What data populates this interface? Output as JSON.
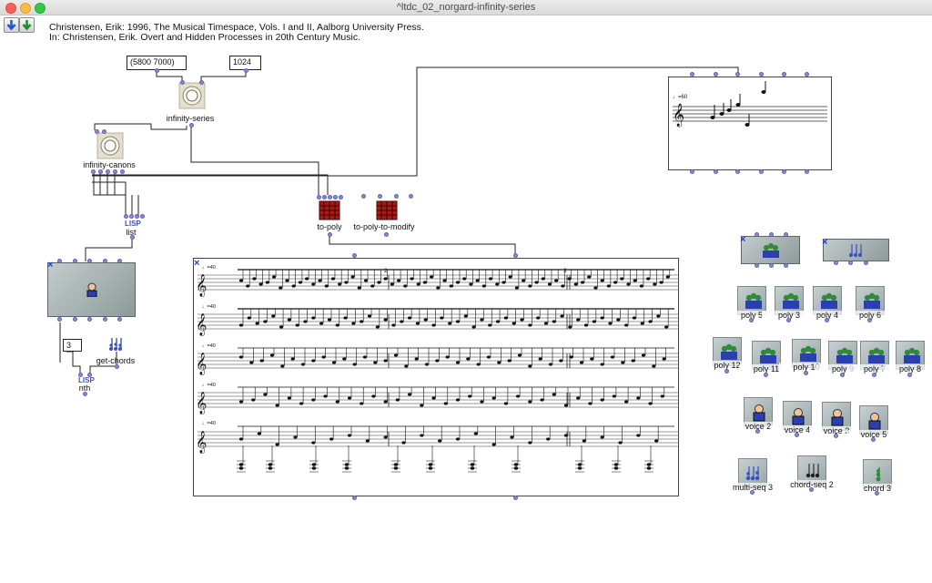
{
  "window": {
    "title": "^ltdc_02_norgard-infinity-series"
  },
  "toolbar": {
    "back_icon": "arrow-down-blue",
    "forward_icon": "arrow-down-green"
  },
  "credits": {
    "line1": "Christensen, Erik: 1996, The Musical Timespace, Vols. I and II, Aalborg University Press.",
    "line2": "In: Christensen, Erik. Overt and Hidden Processes in 20th Century Music."
  },
  "inputs": {
    "range": "(5800 7000)",
    "length": "1024",
    "nth_index": "3"
  },
  "boxes": {
    "infinity_series": "infinity-series",
    "infinity_canons": "infinity-canons",
    "list": "list",
    "lisp_tag": "LISP",
    "to_poly": "to-poly",
    "to_poly_modify": "to-poly-to-modify",
    "get_chords": "get-chords",
    "nth": "nth"
  },
  "score_editor": {
    "tempo_marks": [
      "♩=40",
      "♩=40",
      "♩=40",
      "♩=40",
      "♩=40"
    ],
    "measure_numbers": [
      "2",
      "3"
    ]
  },
  "preview_score": {
    "tempo": "♩=60"
  },
  "tiles": [
    {
      "label": "poly 5"
    },
    {
      "label": "poly 3"
    },
    {
      "label": "poly 4"
    },
    {
      "label": "poly 6"
    },
    {
      "label": "poly 12"
    },
    {
      "label": "poly 11"
    },
    {
      "label": "poly 10"
    },
    {
      "label": "poly 9"
    },
    {
      "label": "poly 7"
    },
    {
      "label": "poly 8"
    },
    {
      "label": "voice 2"
    },
    {
      "label": "voice 4"
    },
    {
      "label": "voice 3"
    },
    {
      "label": "voice 5"
    },
    {
      "label": "multi-seq 3"
    },
    {
      "label": "chord-seq 2"
    },
    {
      "label": "chord 3"
    }
  ],
  "colors": {
    "inlet": "#8c8ad2",
    "patch": "#9aa6a6",
    "accent_blue": "#1d3fd8",
    "red_box": "#b01818"
  }
}
